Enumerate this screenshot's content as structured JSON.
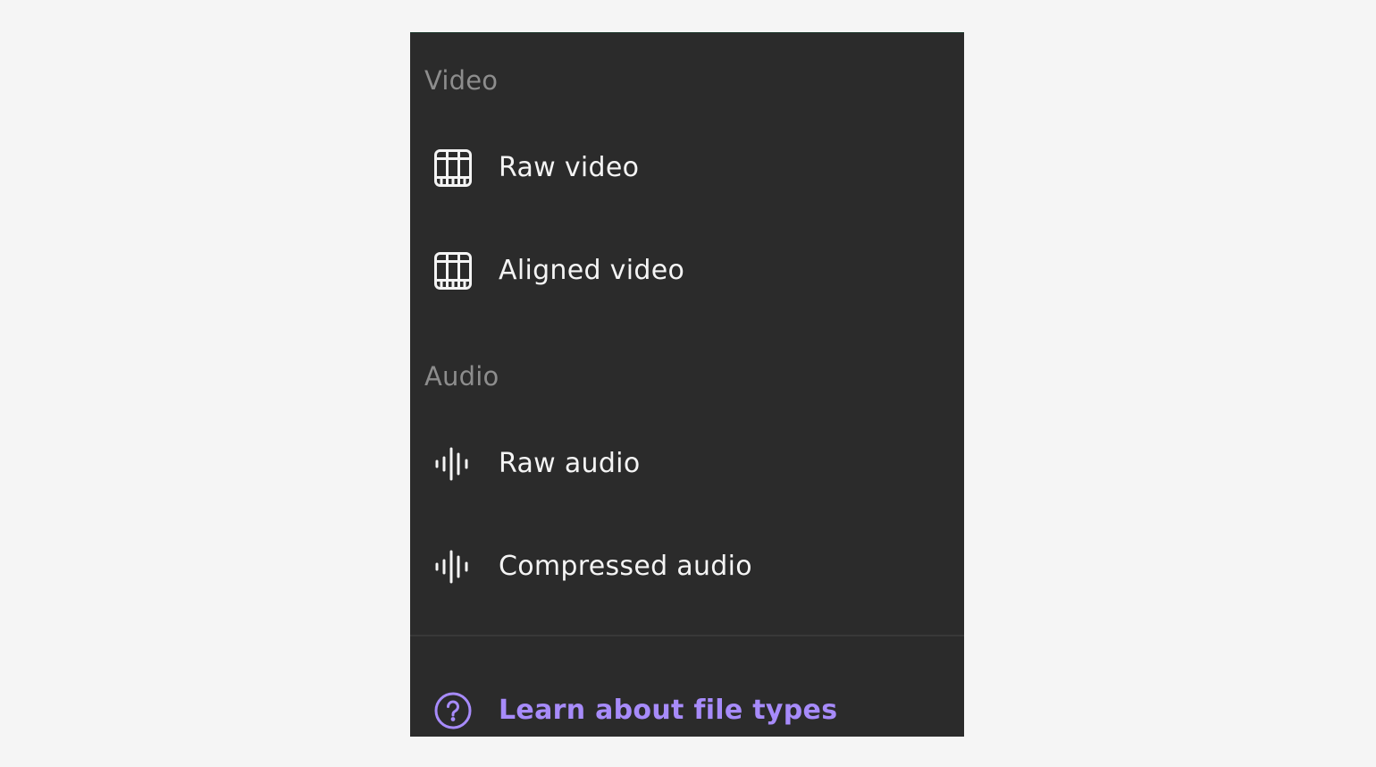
{
  "menu": {
    "sections": [
      {
        "header": "Video",
        "items": [
          {
            "label": "Raw video",
            "icon": "film-icon"
          },
          {
            "label": "Aligned video",
            "icon": "film-icon"
          }
        ]
      },
      {
        "header": "Audio",
        "items": [
          {
            "label": "Raw audio",
            "icon": "audio-waveform-icon"
          },
          {
            "label": "Compressed audio",
            "icon": "audio-waveform-icon"
          }
        ]
      }
    ],
    "footer_link": {
      "label": "Learn about file types",
      "icon": "help-circle-icon"
    }
  },
  "colors": {
    "panel_background": "#2b2b2b",
    "page_background": "#f5f5f5",
    "section_header": "#8d8d8d",
    "item_text": "#f4f4f4",
    "link_accent": "#a78bfa"
  }
}
